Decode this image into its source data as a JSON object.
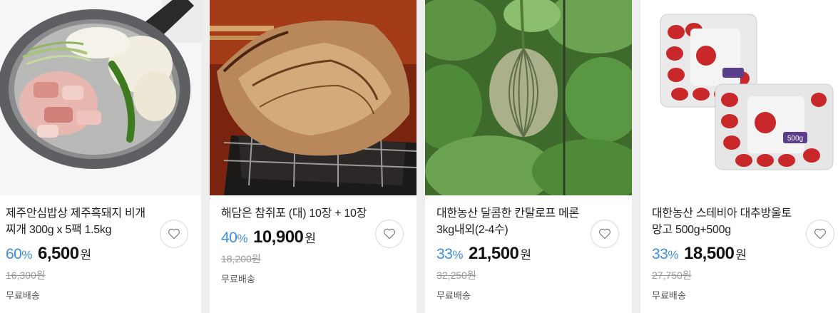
{
  "products": [
    {
      "title": "제주안심밥상 제주흑돼지 비개찌개 300g x 5팩 1.5kg",
      "discount": "60",
      "pct": "%",
      "price": "6,500",
      "won": "원",
      "original_price": "16,300원",
      "shipping": "무료배송",
      "image": "pork-stew-pan",
      "accent": "#3f8ed8"
    },
    {
      "title": "해담은 참쥐포 (대) 10장 + 10장",
      "discount": "40",
      "pct": "%",
      "price": "10,900",
      "won": "원",
      "original_price": "18,200원",
      "shipping": "무료배송",
      "image": "grilled-filefish-jerky"
    },
    {
      "title": "대한농산 달콤한 칸탈로프 메론 3kg내외(2-4수)",
      "discount": "33",
      "pct": "%",
      "price": "21,500",
      "won": "원",
      "original_price": "32,250원",
      "shipping": "무료배송",
      "image": "cantaloupe-melon-vine"
    },
    {
      "title": "대한농산 스테비아 대추방울토망고 500g+500g",
      "discount": "33",
      "pct": "%",
      "price": "18,500",
      "won": "원",
      "original_price": "27,750원",
      "shipping": "무료배송",
      "image": "tomato-packs",
      "pack_label": "500g"
    }
  ]
}
